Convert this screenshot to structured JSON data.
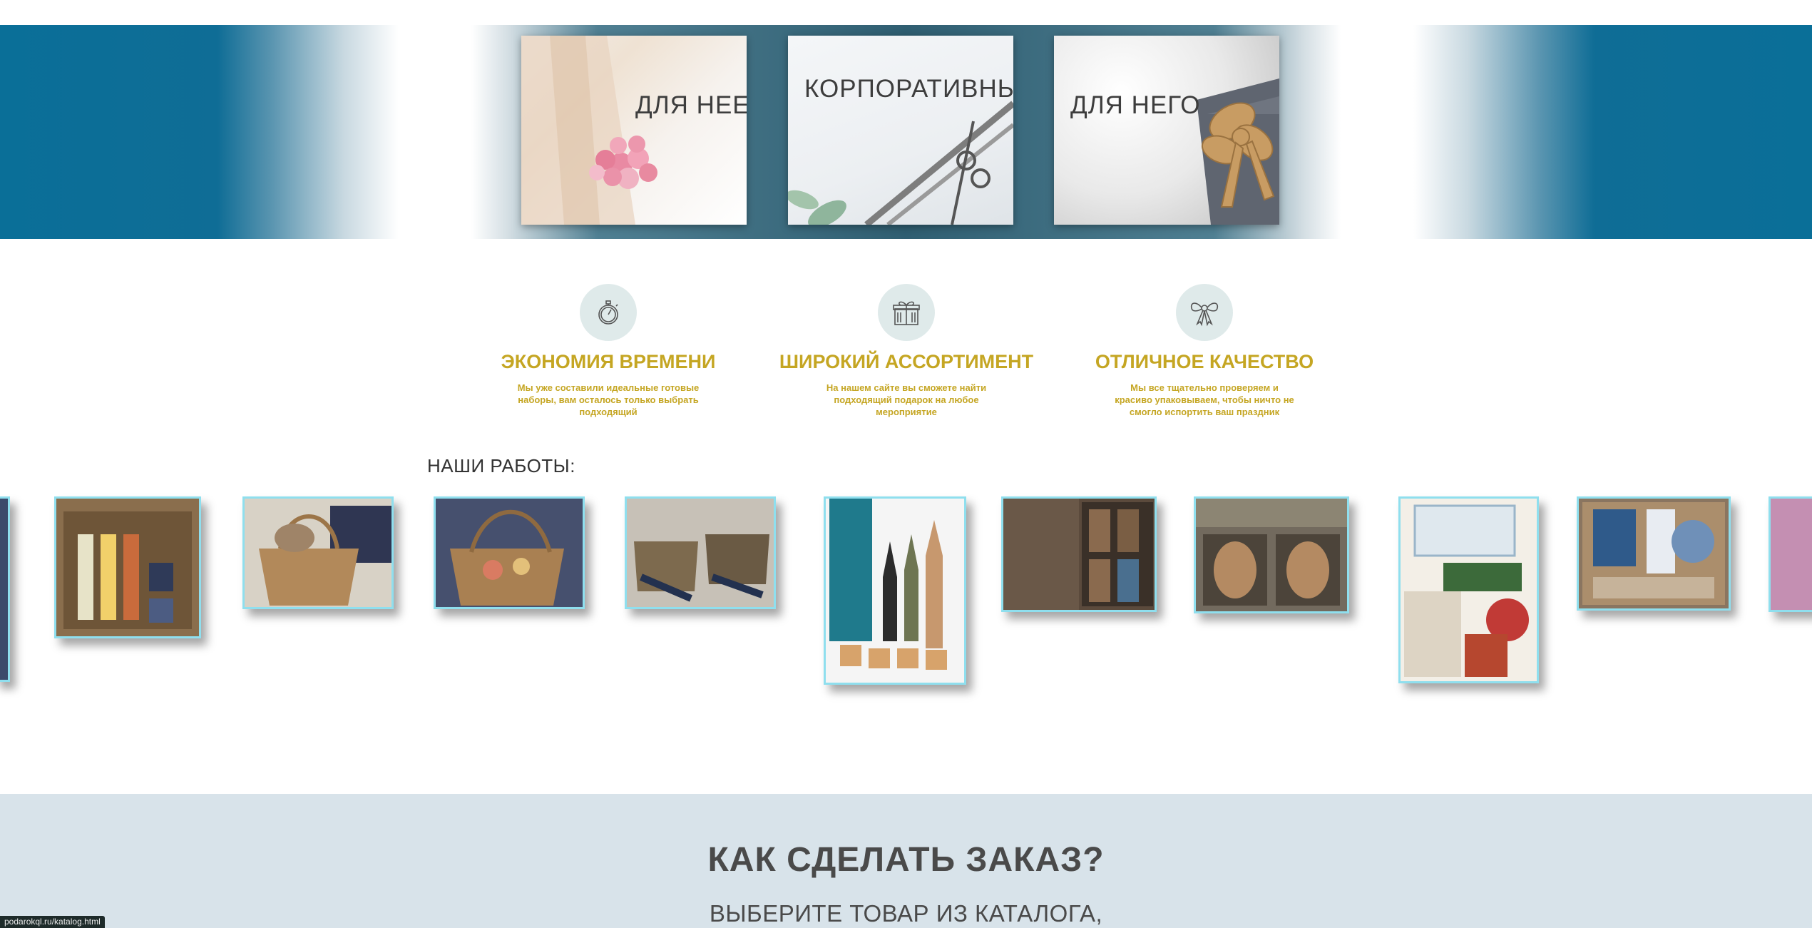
{
  "hero": {
    "cards": [
      {
        "title": "ДЛЯ НЕЕ"
      },
      {
        "title": "КОРПОРАТИВНЫЕ"
      },
      {
        "title": "ДЛЯ НЕГО"
      }
    ]
  },
  "features": [
    {
      "icon": "stopwatch-icon",
      "title": "ЭКОНОМИЯ ВРЕМЕНИ",
      "desc": "Мы уже составили идеальные готовые наборы, вам осталось только выбрать подходящий"
    },
    {
      "icon": "gift-box-icon",
      "title": "ШИРОКИЙ АССОРТИМЕНТ",
      "desc": "На нашем сайте вы сможете найти подходящий подарок на любое мероприятие"
    },
    {
      "icon": "bow-icon",
      "title": "ОТЛИЧНОЕ КАЧЕСТВО",
      "desc": "Мы все тщательно проверяем и красиво упаковываем, чтобы ничто не смогло испортить ваш праздник"
    }
  ],
  "works": {
    "title": "НАШИ РАБОТЫ:"
  },
  "order": {
    "title": "КАК СДЕЛАТЬ ЗАКАЗ?",
    "subtitle": "ВЫБЕРИТЕ ТОВАР ИЗ КАТАЛОГА,"
  },
  "status": {
    "url": "podarokql.ru/katalog.html"
  },
  "colors": {
    "accent": "#c5a623",
    "hero_blue": "#0a6f98",
    "order_bg": "#d8e3ea",
    "frame": "#8fdfee"
  }
}
